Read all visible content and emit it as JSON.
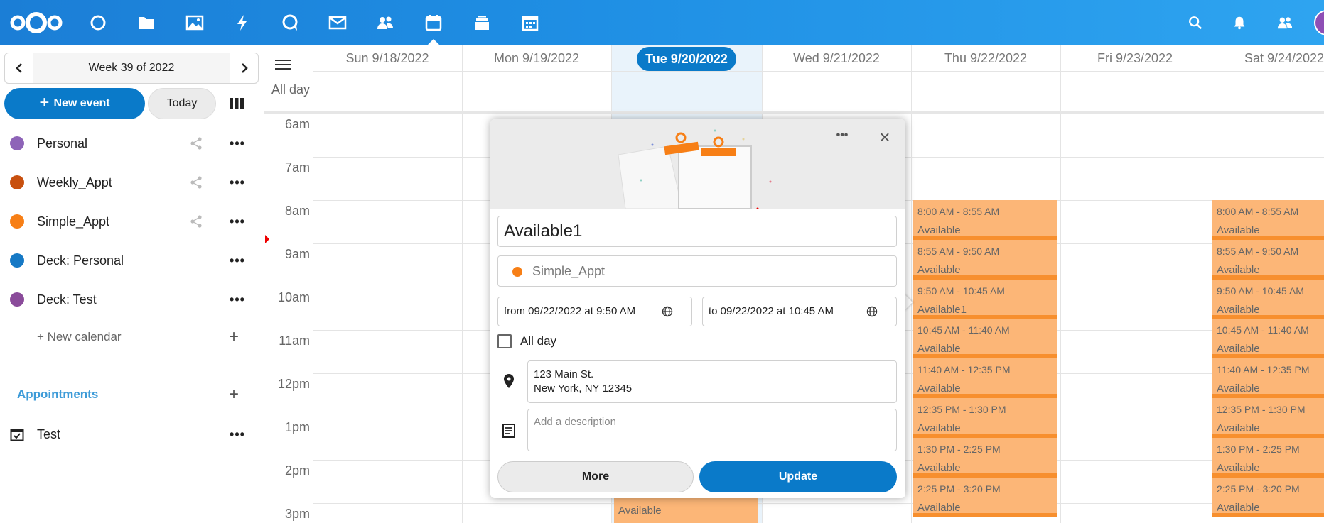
{
  "topbar": {
    "apps": [
      "dashboard",
      "files",
      "photos",
      "activity",
      "talk",
      "mail",
      "contacts",
      "calendar",
      "deck",
      "tasks"
    ],
    "active_app": "calendar",
    "right_icons": [
      "search-icon",
      "bell-icon",
      "contacts-menu-icon",
      "avatar"
    ],
    "colors": {
      "bar_start": "#1b7ed6",
      "bar_end": "#2ea4f0"
    }
  },
  "sidebar": {
    "week_label": "Week 39 of 2022",
    "new_event_label": "New event",
    "today_label": "Today",
    "calendars": [
      {
        "name": "Personal",
        "color": "#8e64b8",
        "shared": true
      },
      {
        "name": "Weekly_Appt",
        "color": "#c8500f",
        "shared": true
      },
      {
        "name": "Simple_Appt",
        "color": "#f77f16",
        "shared": true
      },
      {
        "name": "Deck: Personal",
        "color": "#1679c5",
        "shared": false
      },
      {
        "name": "Deck: Test",
        "color": "#8a4b9a",
        "shared": false
      }
    ],
    "new_calendar_label": "+ New calendar",
    "appointments_heading": "Appointments",
    "appointments": [
      {
        "name": "Test"
      }
    ]
  },
  "grid": {
    "days": [
      "Sun 9/18/2022",
      "Mon 9/19/2022",
      "Tue 9/20/2022",
      "Wed 9/21/2022",
      "Thu 9/22/2022",
      "Fri 9/23/2022",
      "Sat 9/24/2022"
    ],
    "today_index": 2,
    "all_day_label": "All day",
    "hours": [
      "6am",
      "7am",
      "8am",
      "9am",
      "10am",
      "11am",
      "12pm",
      "1pm",
      "2pm",
      "3pm"
    ],
    "thu_events": [
      {
        "time": "8:00 AM - 8:55 AM",
        "name": "Available"
      },
      {
        "time": "8:55 AM - 9:50 AM",
        "name": "Available"
      },
      {
        "time": "9:50 AM - 10:45 AM",
        "name": "Available1"
      },
      {
        "time": "10:45 AM - 11:40 AM",
        "name": "Available"
      },
      {
        "time": "11:40 AM - 12:35 PM",
        "name": "Available"
      },
      {
        "time": "12:35 PM - 1:30 PM",
        "name": "Available"
      },
      {
        "time": "1:30 PM - 2:25 PM",
        "name": "Available"
      },
      {
        "time": "2:25 PM - 3:20 PM",
        "name": "Available"
      }
    ],
    "sat_events": [
      {
        "time": "8:00 AM - 8:55 AM",
        "name": "Available"
      },
      {
        "time": "8:55 AM - 9:50 AM",
        "name": "Available"
      },
      {
        "time": "9:50 AM - 10:45 AM",
        "name": "Available"
      },
      {
        "time": "10:45 AM - 11:40 AM",
        "name": "Available"
      },
      {
        "time": "11:40 AM - 12:35 PM",
        "name": "Available"
      },
      {
        "time": "12:35 PM - 1:30 PM",
        "name": "Available"
      },
      {
        "time": "1:30 PM - 2:25 PM",
        "name": "Available"
      },
      {
        "time": "2:25 PM - 3:20 PM",
        "name": "Available"
      }
    ],
    "tue_event_name": "Available",
    "event_color": "#fcb677"
  },
  "popover": {
    "title": "Available1",
    "calendar": "Simple_Appt",
    "from": "from 09/22/2022 at 9:50 AM",
    "to": "to 09/22/2022 at 10:45 AM",
    "all_day_label": "All day",
    "location_line1": "123 Main St.",
    "location_line2": "New York, NY 12345",
    "description_placeholder": "Add a description",
    "more_label": "More",
    "update_label": "Update"
  }
}
